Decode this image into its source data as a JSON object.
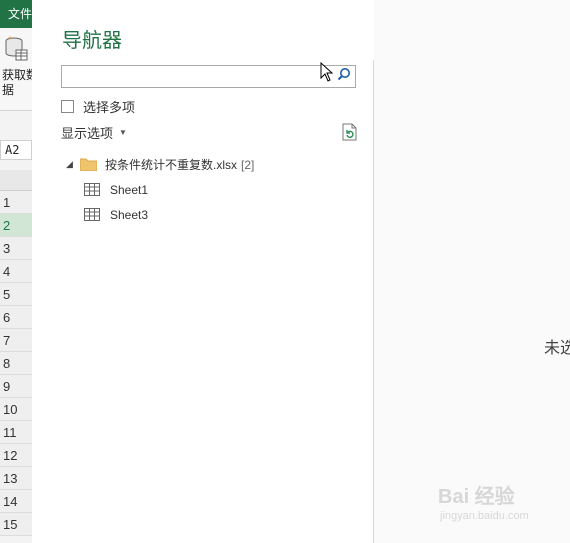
{
  "excel": {
    "file_tab": "文件",
    "get_data_label_1": "获取数",
    "get_data_label_2": "据",
    "name_box": "A2",
    "rows": [
      "1",
      "2",
      "3",
      "4",
      "5",
      "6",
      "7",
      "8",
      "9",
      "10",
      "11",
      "12",
      "13",
      "14",
      "15"
    ],
    "selected_row": "2",
    "accent": "#217346"
  },
  "navigator": {
    "title": "导航器",
    "search_placeholder": "",
    "select_multiple_label": "选择多项",
    "display_options_label": "显示选项",
    "tree": {
      "file_name": "按条件统计不重复数.xlsx",
      "count": "[2]",
      "sheets": [
        "Sheet1",
        "Sheet3"
      ]
    },
    "preview_message": "未选"
  },
  "watermark": {
    "main": "Bai 经验",
    "sub": "jingyan.baidu.com"
  }
}
